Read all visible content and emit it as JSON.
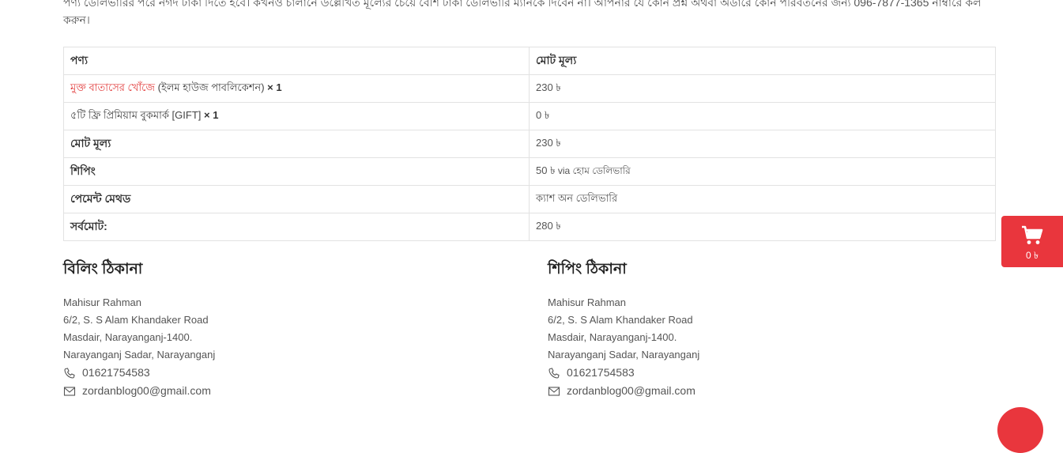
{
  "notice": "পণ্য ডেলিভারির পরে নগদ টাকা দিতে হবে। কখনও চালানে উল্লেখিত মূল্যের চেয়ে বেশি টাকা ডেলিভারি ম্যানকে দিবেন না। আপনার যে কোন প্রশ্ন অথবা অর্ডারে কোন পরিবর্তনের জন্য 096-7877-1365 নাম্বারে কল করুন।",
  "table": {
    "header_product": "পণ্য",
    "header_total": "মোট মূল্য",
    "items": [
      {
        "name": "মুক্ত বাতাসের খোঁজে",
        "publisher": " (ইলম হাউজ পাবলিকেশন)",
        "qty": " × 1",
        "price": "230 ৳"
      },
      {
        "name": "৫টি ফ্রি প্রিমিয়াম বুকমার্ক [GIFT]",
        "qty": " × 1",
        "price": "0 ৳"
      }
    ],
    "subtotal_label": "মোট মূল্য",
    "subtotal_value": "230 ৳",
    "shipping_label": "শিপিং",
    "shipping_value": "50 ৳",
    "shipping_via": " via হোম ডেলিভারি",
    "payment_label": "পেমেন্ট মেথড",
    "payment_value": "ক্যাশ অন ডেলিভারি",
    "total_label": "সর্বমোট:",
    "total_value": "280 ৳"
  },
  "billing": {
    "title": "বিলিং ঠিকানা",
    "name": "Mahisur Rahman",
    "line1": "6/2, S. S Alam Khandaker Road",
    "line2": "Masdair, Narayanganj-1400.",
    "line3": "Narayanganj Sadar, Narayanganj",
    "phone": "01621754583",
    "email": "zordanblog00@gmail.com"
  },
  "shipping_addr": {
    "title": "শিপিং ঠিকানা",
    "name": "Mahisur Rahman",
    "line1": "6/2, S. S Alam Khandaker Road",
    "line2": "Masdair, Narayanganj-1400.",
    "line3": "Narayanganj Sadar, Narayanganj",
    "phone": "01621754583",
    "email": "zordanblog00@gmail.com"
  },
  "cart": {
    "icon": "shopping-cart-icon",
    "total": "0 ৳"
  },
  "colors": {
    "accent": "#e9363d",
    "link": "#e23b3b"
  }
}
